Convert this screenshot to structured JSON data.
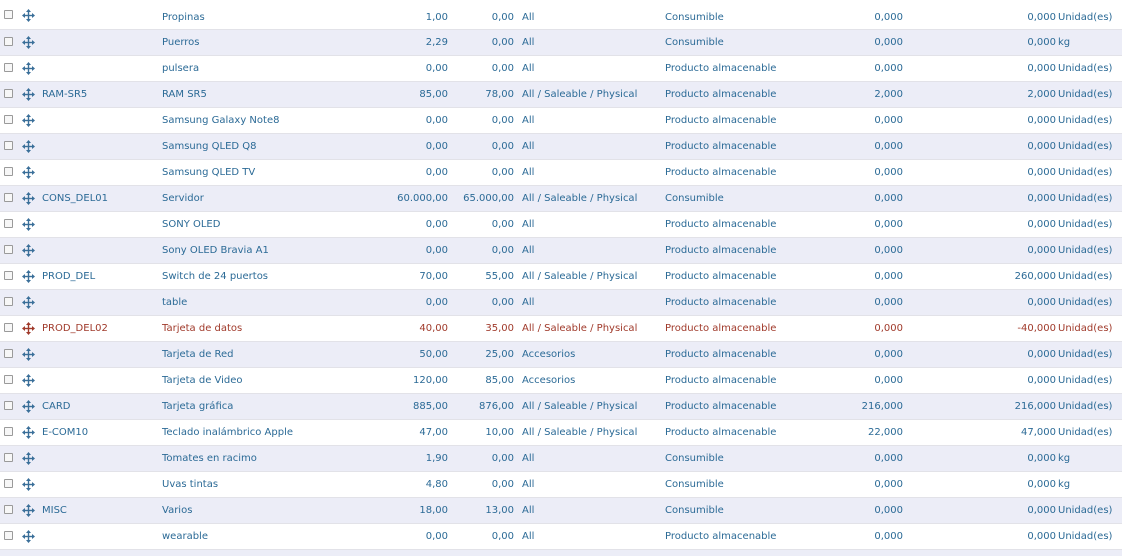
{
  "colors": {
    "text": "#2b6a96",
    "danger_text": "#a03a2b",
    "alt_row_bg": "#ecedf7",
    "row_border": "#e2e2e8"
  },
  "icons": {
    "row_handle": "move-arrows-icon"
  },
  "rows": [
    {
      "ref": "",
      "name": "Propinas",
      "sale": "1,00",
      "cost": "0,00",
      "category": "All",
      "type": "Consumible",
      "qty": "0,000",
      "forecast": "0,000",
      "uom": "Unidad(es)"
    },
    {
      "ref": "",
      "name": "Puerros",
      "sale": "2,29",
      "cost": "0,00",
      "category": "All",
      "type": "Consumible",
      "qty": "0,000",
      "forecast": "0,000",
      "uom": "kg"
    },
    {
      "ref": "",
      "name": "pulsera",
      "sale": "0,00",
      "cost": "0,00",
      "category": "All",
      "type": "Producto almacenable",
      "qty": "0,000",
      "forecast": "0,000",
      "uom": "Unidad(es)"
    },
    {
      "ref": "RAM-SR5",
      "name": "RAM SR5",
      "sale": "85,00",
      "cost": "78,00",
      "category": "All / Saleable / Physical",
      "type": "Producto almacenable",
      "qty": "2,000",
      "forecast": "2,000",
      "uom": "Unidad(es)"
    },
    {
      "ref": "",
      "name": "Samsung Galaxy Note8",
      "sale": "0,00",
      "cost": "0,00",
      "category": "All",
      "type": "Producto almacenable",
      "qty": "0,000",
      "forecast": "0,000",
      "uom": "Unidad(es)"
    },
    {
      "ref": "",
      "name": "Samsung QLED Q8",
      "sale": "0,00",
      "cost": "0,00",
      "category": "All",
      "type": "Producto almacenable",
      "qty": "0,000",
      "forecast": "0,000",
      "uom": "Unidad(es)"
    },
    {
      "ref": "",
      "name": "Samsung QLED TV",
      "sale": "0,00",
      "cost": "0,00",
      "category": "All",
      "type": "Producto almacenable",
      "qty": "0,000",
      "forecast": "0,000",
      "uom": "Unidad(es)"
    },
    {
      "ref": "CONS_DEL01",
      "name": "Servidor",
      "sale": "60.000,00",
      "cost": "65.000,00",
      "category": "All / Saleable / Physical",
      "type": "Consumible",
      "qty": "0,000",
      "forecast": "0,000",
      "uom": "Unidad(es)"
    },
    {
      "ref": "",
      "name": "SONY OLED",
      "sale": "0,00",
      "cost": "0,00",
      "category": "All",
      "type": "Producto almacenable",
      "qty": "0,000",
      "forecast": "0,000",
      "uom": "Unidad(es)"
    },
    {
      "ref": "",
      "name": "Sony OLED Bravia A1",
      "sale": "0,00",
      "cost": "0,00",
      "category": "All",
      "type": "Producto almacenable",
      "qty": "0,000",
      "forecast": "0,000",
      "uom": "Unidad(es)"
    },
    {
      "ref": "PROD_DEL",
      "name": "Switch de 24 puertos",
      "sale": "70,00",
      "cost": "55,00",
      "category": "All / Saleable / Physical",
      "type": "Producto almacenable",
      "qty": "0,000",
      "forecast": "260,000",
      "uom": "Unidad(es)"
    },
    {
      "ref": "",
      "name": "table",
      "sale": "0,00",
      "cost": "0,00",
      "category": "All",
      "type": "Producto almacenable",
      "qty": "0,000",
      "forecast": "0,000",
      "uom": "Unidad(es)"
    },
    {
      "ref": "PROD_DEL02",
      "name": "Tarjeta de datos",
      "sale": "40,00",
      "cost": "35,00",
      "category": "All / Saleable / Physical",
      "type": "Producto almacenable",
      "qty": "0,000",
      "forecast": "-40,000",
      "uom": "Unidad(es)",
      "danger": true
    },
    {
      "ref": "",
      "name": "Tarjeta de Red",
      "sale": "50,00",
      "cost": "25,00",
      "category": "Accesorios",
      "type": "Producto almacenable",
      "qty": "0,000",
      "forecast": "0,000",
      "uom": "Unidad(es)"
    },
    {
      "ref": "",
      "name": "Tarjeta de Video",
      "sale": "120,00",
      "cost": "85,00",
      "category": "Accesorios",
      "type": "Producto almacenable",
      "qty": "0,000",
      "forecast": "0,000",
      "uom": "Unidad(es)"
    },
    {
      "ref": "CARD",
      "name": "Tarjeta gráfica",
      "sale": "885,00",
      "cost": "876,00",
      "category": "All / Saleable / Physical",
      "type": "Producto almacenable",
      "qty": "216,000",
      "forecast": "216,000",
      "uom": "Unidad(es)"
    },
    {
      "ref": "E-COM10",
      "name": "Teclado inalámbrico Apple",
      "sale": "47,00",
      "cost": "10,00",
      "category": "All / Saleable / Physical",
      "type": "Producto almacenable",
      "qty": "22,000",
      "forecast": "47,000",
      "uom": "Unidad(es)"
    },
    {
      "ref": "",
      "name": "Tomates en racimo",
      "sale": "1,90",
      "cost": "0,00",
      "category": "All",
      "type": "Consumible",
      "qty": "0,000",
      "forecast": "0,000",
      "uom": "kg"
    },
    {
      "ref": "",
      "name": "Uvas tintas",
      "sale": "4,80",
      "cost": "0,00",
      "category": "All",
      "type": "Consumible",
      "qty": "0,000",
      "forecast": "0,000",
      "uom": "kg"
    },
    {
      "ref": "MISC",
      "name": "Varios",
      "sale": "18,00",
      "cost": "13,00",
      "category": "All",
      "type": "Consumible",
      "qty": "0,000",
      "forecast": "0,000",
      "uom": "Unidad(es)"
    },
    {
      "ref": "",
      "name": "wearable",
      "sale": "0,00",
      "cost": "0,00",
      "category": "All",
      "type": "Producto almacenable",
      "qty": "0,000",
      "forecast": "0,000",
      "uom": "Unidad(es)"
    }
  ]
}
